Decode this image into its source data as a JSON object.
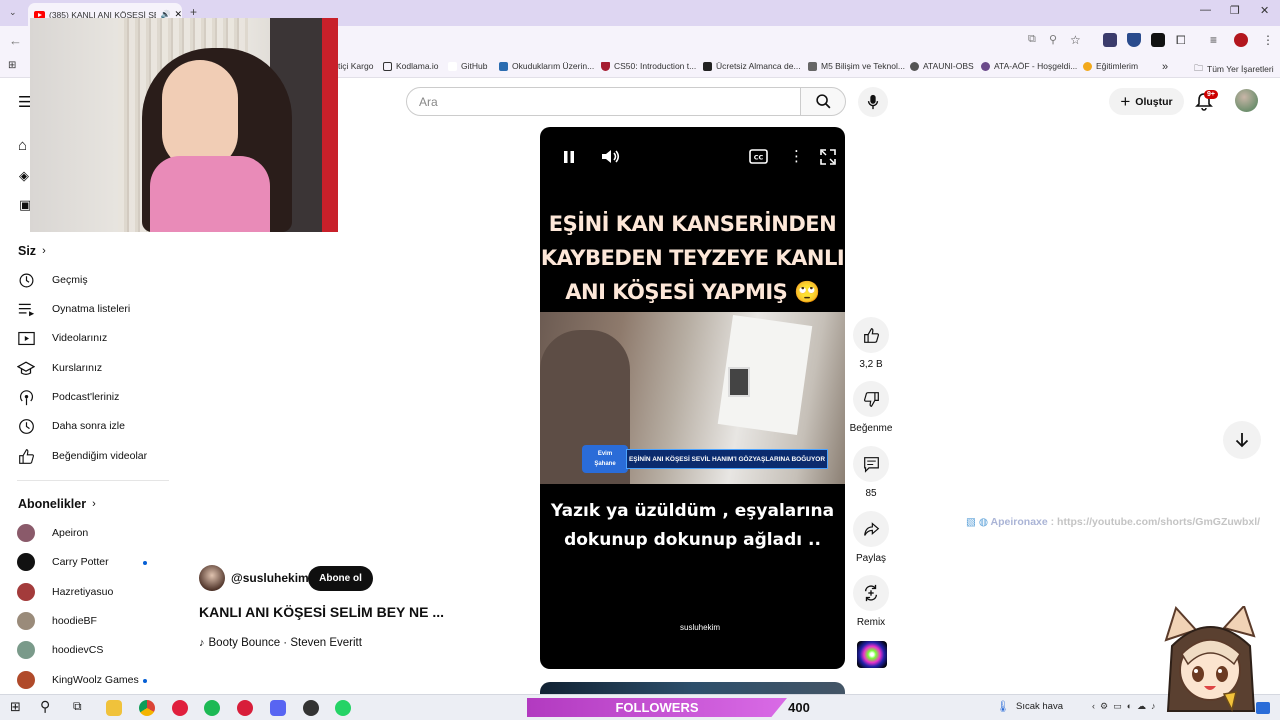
{
  "browser": {
    "tab_title": "(385) KANLI ANI KÖŞESİ SE",
    "bookmarks": [
      "tiçi Kargo",
      "Kodlama.io",
      "GitHub",
      "Okuduklarım Üzerin...",
      "CS50: Introduction t...",
      "Ücretsiz Almanca de...",
      "M5 Bilişim ve Teknol...",
      "ATAUNI-OBS",
      "ATA-AÖF - Hoşgeldi...",
      "Eğitimlerim",
      "Tüm Yer İşaretleri"
    ],
    "more_bookmarks": "»"
  },
  "topbar": {
    "search_placeholder": "Ara",
    "create_label": "Oluştur",
    "notif_count": "9+"
  },
  "sidebar": {
    "you_header": "Siz",
    "you_items": [
      {
        "label": "Geçmiş",
        "icon": "history-icon"
      },
      {
        "label": "Oynatma listeleri",
        "icon": "playlists-icon"
      },
      {
        "label": "Videolarınız",
        "icon": "your-videos-icon"
      },
      {
        "label": "Kurslarınız",
        "icon": "courses-icon"
      },
      {
        "label": "Podcast'leriniz",
        "icon": "podcasts-icon"
      },
      {
        "label": "Daha sonra izle",
        "icon": "watch-later-icon"
      },
      {
        "label": "Beğendiğim videolar",
        "icon": "liked-videos-icon"
      }
    ],
    "subs_header": "Abonelikler",
    "subscriptions": [
      {
        "name": "Apeiron",
        "color": "#8a5a6a",
        "new": false
      },
      {
        "name": "Carry Potter",
        "color": "#111111",
        "new": true
      },
      {
        "name": "Hazretiyasuo",
        "color": "#a33b3b",
        "new": false
      },
      {
        "name": "hoodieBF",
        "color": "#9a8b7a",
        "new": false
      },
      {
        "name": "hoodievCS",
        "color": "#7a9a8a",
        "new": false
      },
      {
        "name": "KingWoolz Games",
        "color": "#b04a2a",
        "new": true
      }
    ]
  },
  "video": {
    "caption_title_lines": [
      "EŞİNİ KAN KANSERİNDEN",
      "KAYBEDEN TEYZEYE KANLI",
      "ANI KÖŞESİ YAPMIŞ 🙄"
    ],
    "caption_body_lines": [
      "Yazık ya üzüldüm , eşyalarına",
      "dokunup dokunup ağladı .."
    ],
    "channel_watermark": "susluhekim",
    "lower_third": "EŞİNİN ANI KÖŞESİ SEVİL HANIM'I GÖZYAŞLARINA BOĞUYOR",
    "show_logo_top": "Evim",
    "show_logo_bottom": "Şahane"
  },
  "actions": {
    "like_count": "3,2 B",
    "dislike_label": "Beğenme",
    "comment_count": "85",
    "share_label": "Paylaş",
    "remix_label": "Remix"
  },
  "meta": {
    "channel": "@susluhekim",
    "subscribe_label": "Abone ol",
    "title": "KANLI ANI KÖŞESİ SELİM BEY NE ...",
    "music": "Booty Bounce · Steven Everitt"
  },
  "chat": {
    "user": "Apeironaxe",
    "message": ": https://youtube.com/shorts/GmGZuwbxl/"
  },
  "overlay": {
    "followers_label": "FOLLOWERS",
    "followers_count": "400"
  },
  "taskbar": {
    "weather": "Sıcak hava"
  },
  "colors": {
    "accent_red": "#ff0000",
    "new_dot": "#065fd4",
    "followers_bar": "#c24fd0"
  }
}
